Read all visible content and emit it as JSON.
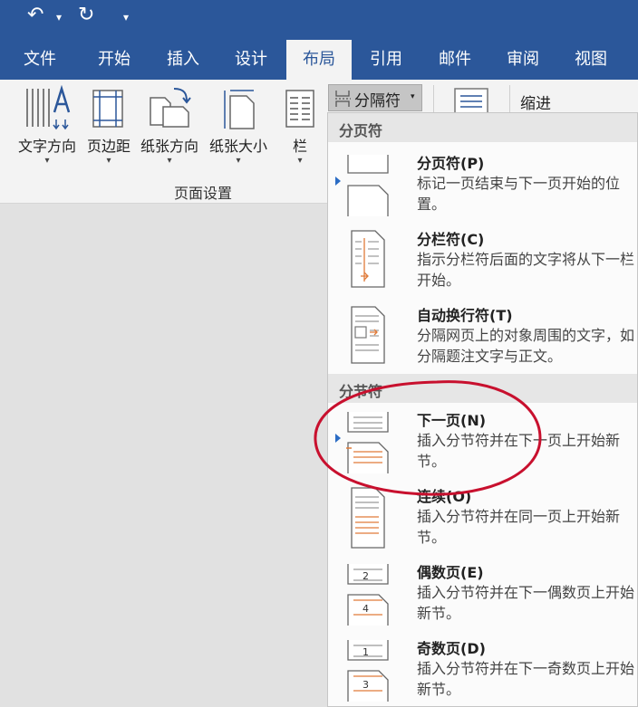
{
  "quick_access": {
    "undo_icon": "↶",
    "dropdown": "▾",
    "redo_icon": "↻",
    "customize": "▾"
  },
  "tabs": [
    {
      "label": "文件"
    },
    {
      "label": "开始"
    },
    {
      "label": "插入"
    },
    {
      "label": "设计"
    },
    {
      "label": "布局"
    },
    {
      "label": "引用"
    },
    {
      "label": "邮件"
    },
    {
      "label": "审阅"
    },
    {
      "label": "视图"
    }
  ],
  "ribbon": {
    "buttons": [
      {
        "label": "文字方向",
        "arrow": "▾"
      },
      {
        "label": "页边距",
        "arrow": "▾"
      },
      {
        "label": "纸张方向",
        "arrow": "▾"
      },
      {
        "label": "纸张大小",
        "arrow": "▾"
      },
      {
        "label": "栏",
        "arrow": "▾"
      }
    ],
    "group_label": "页面设置",
    "breaks_button": "分隔符",
    "breaks_caret": "▾",
    "indent_label": "缩进"
  },
  "menu": {
    "page_breaks_header": "分页符",
    "section_breaks_header": "分节符",
    "items": [
      {
        "title": "分页符(P)",
        "desc": "标记一页结束与下一页开始的位置。"
      },
      {
        "title": "分栏符(C)",
        "desc": "指示分栏符后面的文字将从下一栏开始。"
      },
      {
        "title": "自动换行符(T)",
        "desc": "分隔网页上的对象周围的文字，如分隔题注文字与正文。"
      },
      {
        "title": "下一页(N)",
        "desc": "插入分节符并在下一页上开始新节。"
      },
      {
        "title": "连续(O)",
        "desc": "插入分节符并在同一页上开始新节。"
      },
      {
        "title": "偶数页(E)",
        "desc": "插入分节符并在下一偶数页上开始新节。"
      },
      {
        "title": "奇数页(D)",
        "desc": "插入分节符并在下一奇数页上开始新节。"
      }
    ],
    "even_page_number": "2",
    "even_page_number_b": "4",
    "odd_page_number": "1",
    "odd_page_number_b": "3"
  },
  "colors": {
    "accent": "#2b579a",
    "annotation": "#c8102e",
    "break_line": "#e07b39"
  }
}
